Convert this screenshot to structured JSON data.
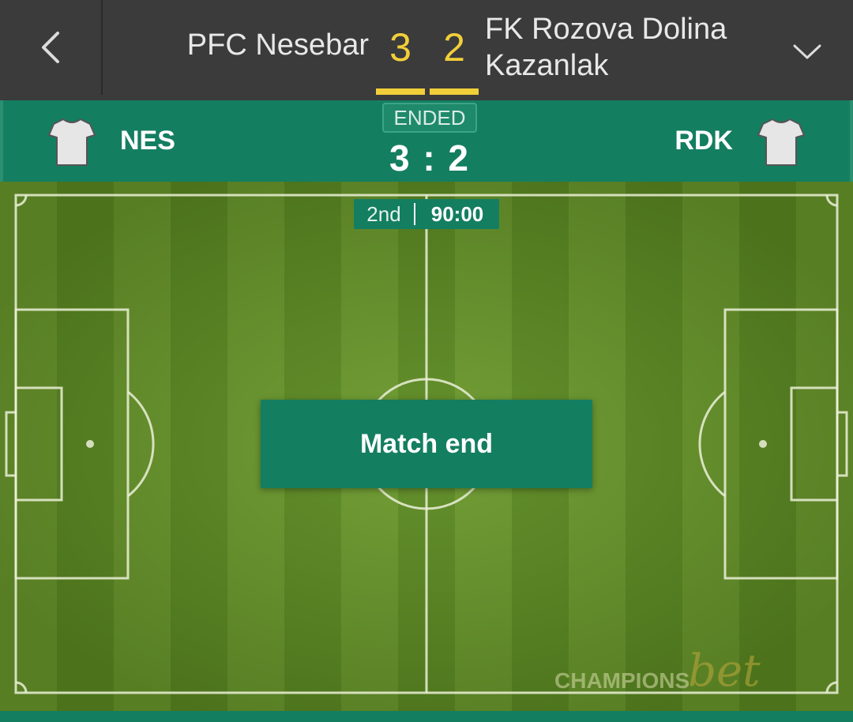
{
  "topbar": {
    "home_team": "PFC Nesebar",
    "home_score": "3",
    "away_score": "2",
    "away_team_line1": "FK Rozova Dolina",
    "away_team_line2": "Kazanlak"
  },
  "match_header": {
    "status": "ENDED",
    "home_abbr": "NES",
    "away_abbr": "RDK",
    "score_display": "3 : 2"
  },
  "pitch": {
    "period": "2nd",
    "clock": "90:00",
    "event_label": "Match end"
  },
  "watermark": {
    "text": "CHAMPIONS",
    "script": "bet"
  },
  "colors": {
    "topbar_bg": "#3b3b3b",
    "accent_yellow": "#f1cf39",
    "brand_green": "#147e61",
    "pitch_light": "#6b9a2c",
    "pitch_dark": "#5d8c22"
  },
  "icons": {
    "back": "chevron-left-icon",
    "expand": "chevron-down-icon",
    "home_kit": "shirt-icon",
    "away_kit": "shirt-icon"
  }
}
